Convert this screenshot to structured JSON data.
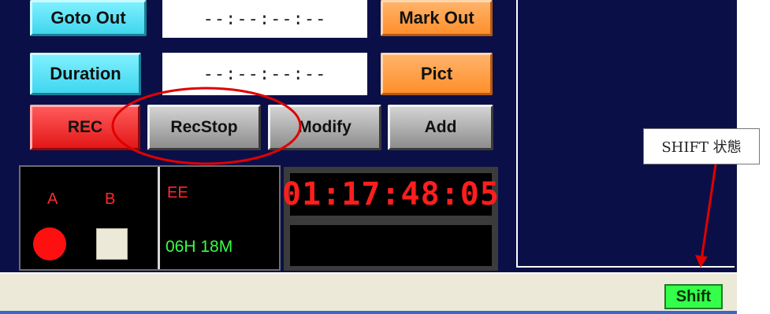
{
  "editor": {
    "goto_out_label": "Goto Out",
    "goto_out_value": "--:--:--:--",
    "mark_out_label": "Mark Out",
    "duration_label": "Duration",
    "duration_value": "--:--:--:--",
    "pict_label": "Pict",
    "buttons": {
      "rec": "REC",
      "recstop": "RecStop",
      "modify": "Modify",
      "add": "Add"
    }
  },
  "status_panel": {
    "channel_a": "A",
    "channel_b": "B",
    "mode": "EE",
    "remaining": "06H 18M"
  },
  "timecode": {
    "display": "01:17:48:05"
  },
  "statusbar": {
    "shift_label": "Shift"
  },
  "annotation": {
    "callout_text": "SHIFT 状態"
  },
  "colors": {
    "app_background": "#0b0f48",
    "accent_cyan": "#3fd6ee",
    "accent_orange": "#ff8f2b",
    "rec_red": "#e31717",
    "shift_green": "#34ff4a",
    "timecode_red": "#ff1e1e",
    "annotation_red": "#e00000"
  }
}
